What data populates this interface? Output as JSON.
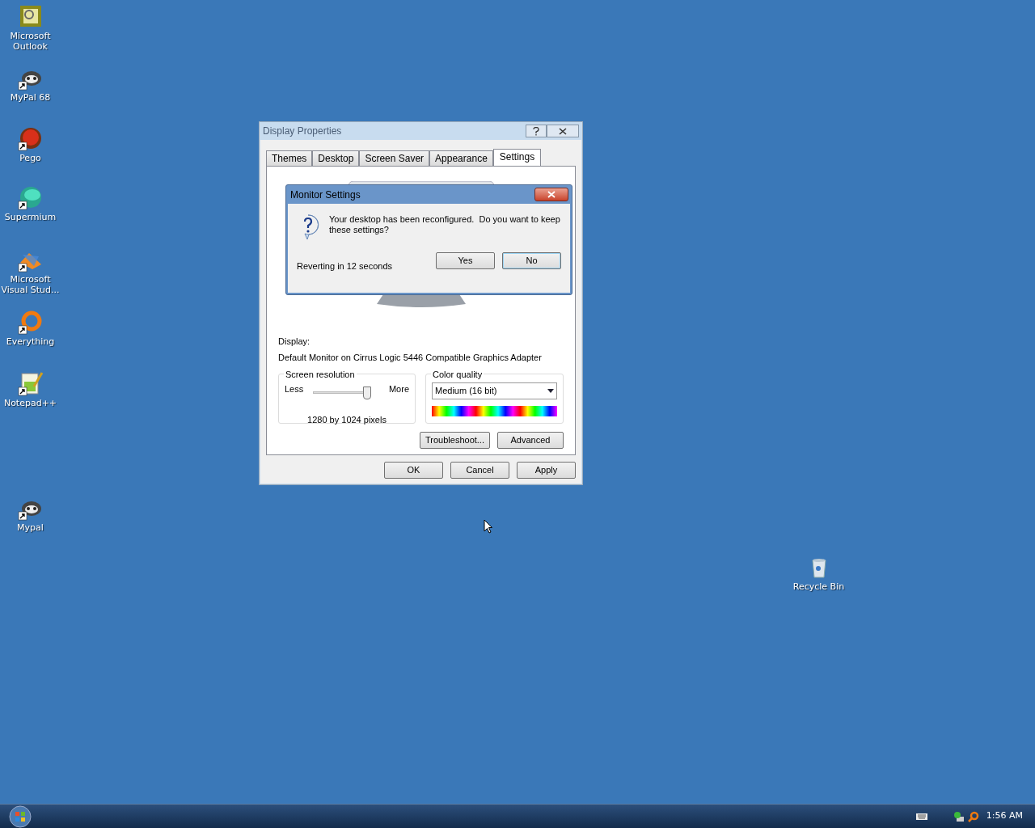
{
  "desktop_icons": [
    {
      "label": "Microsoft Outlook",
      "kind": "outlook",
      "shortcut": false
    },
    {
      "label": "MyPal 68",
      "kind": "mypal",
      "shortcut": true
    },
    {
      "label": "Pego",
      "kind": "pego",
      "shortcut": true
    },
    {
      "label": "Supermium",
      "kind": "supermium",
      "shortcut": true
    },
    {
      "label": "Microsoft Visual Stud...",
      "kind": "vs",
      "shortcut": true
    },
    {
      "label": "Everything",
      "kind": "everything",
      "shortcut": true
    },
    {
      "label": "Notepad++",
      "kind": "notepad",
      "shortcut": true
    },
    {
      "label": "Mypal",
      "kind": "mypal",
      "shortcut": true
    },
    {
      "label": "Recycle Bin",
      "kind": "bin",
      "shortcut": false
    }
  ],
  "window": {
    "title": "Display Properties",
    "active": false,
    "tabs": [
      {
        "label": "Themes",
        "selected": false
      },
      {
        "label": "Desktop",
        "selected": false
      },
      {
        "label": "Screen Saver",
        "selected": false
      },
      {
        "label": "Appearance",
        "selected": false
      },
      {
        "label": "Settings",
        "selected": true
      }
    ],
    "display_label": "Display:",
    "display_value": "Default Monitor on Cirrus Logic 5446 Compatible Graphics Adapter",
    "resolution": {
      "title": "Screen resolution",
      "less": "Less",
      "more": "More",
      "level": 1,
      "value": "1280 by 1024 pixels"
    },
    "color_quality": {
      "title": "Color quality",
      "value": "Medium (16 bit)"
    },
    "panel_buttons": [
      "Troubleshoot...",
      "Advanced"
    ],
    "buttons": [
      "OK",
      "Cancel",
      "Apply"
    ]
  },
  "dialog": {
    "title": "Monitor Settings",
    "message": "Your desktop has been reconfigured.  Do you want to keep these settings?",
    "countdown": "Reverting in 12 seconds",
    "buttons": [
      {
        "label": "Yes",
        "default": false
      },
      {
        "label": "No",
        "default": true
      }
    ]
  },
  "taskbar": {
    "clock": "1:56 AM"
  }
}
